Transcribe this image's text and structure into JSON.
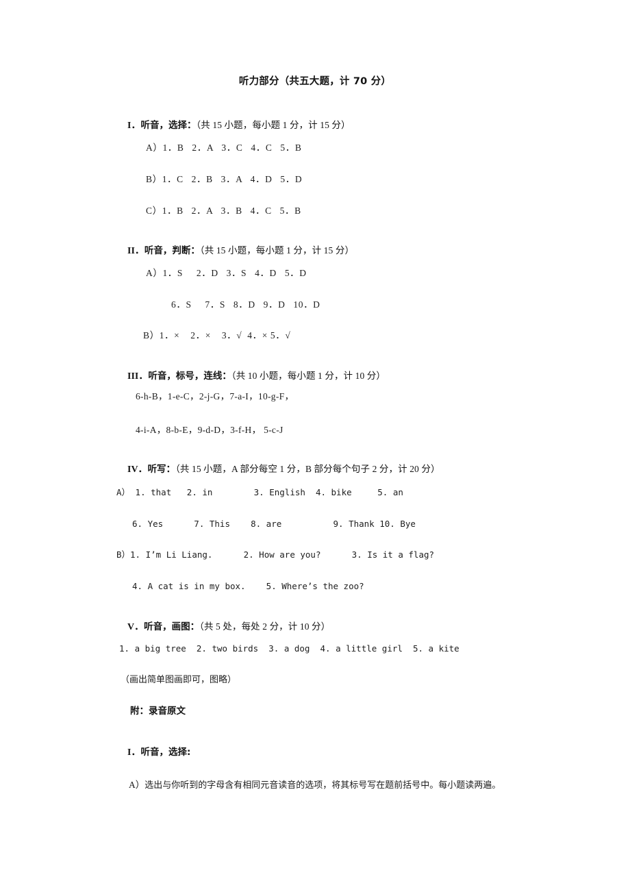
{
  "document": {
    "title": "听力部分（共五大题，计 70 分）"
  },
  "sections": [
    {
      "id": "section-1",
      "number": "I．",
      "name": "听音，选择：",
      "scoring": "（共 15 小题，每小题 1 分，计 15 分）",
      "rows": [
        "A）1．B   2．A   3．C   4．C   5．B",
        "B）1．C   2．B   3．A   4．D   5．D",
        "C）1．B   2．A   3．B   4．C   5．B"
      ]
    },
    {
      "id": "section-2",
      "number": "II．",
      "name": "听音，判断：",
      "scoring": "（共 15 小题，每小题 1 分，计 15 分）",
      "rows": [
        "A）1．S     2．D   3．S   4．D   5．D",
        "6．S     7．S   8．D   9．D   10．D",
        "B）1．×    2．×    3．√  4．× 5．√"
      ]
    },
    {
      "id": "section-3",
      "number": "III．",
      "name": "听音，标号，连线：",
      "scoring": "（共 10 小题，每小题 1 分，计 10 分）",
      "rows": [
        "6-h-B，1-e-C，2-j-G，7-a-I，10-g-F，",
        "4-i-A，8-b-E，9-d-D，3-f-H， 5-c-J"
      ]
    },
    {
      "id": "section-4",
      "number": "IV．",
      "name": "听写：",
      "scoring": "（共 15 小题，A 部分每空 1 分，B 部分每个句子 2 分，计 20 分）",
      "rows": [
        "A） 1. that   2. in        3. English  4. bike     5. an",
        "6. Yes      7. This    8. are          9. Thank 10. Bye",
        "B）1. I’m Li Liang.      2. How are you?      3. Is it a flag?",
        "4. A cat is in my box.    5. Where’s the zoo?"
      ]
    },
    {
      "id": "section-5",
      "number": "V．",
      "name": "听音，画图：",
      "scoring": "（共 5 处，每处 2 分，计 10 分）",
      "rows": [
        "1. a big tree  2. two birds  3. a dog  4. a little girl  5. a kite",
        "（画出简单图画即可，图略）"
      ]
    }
  ],
  "appendix": {
    "heading": "附：录音原文",
    "section_number": "I．",
    "section_name": "听音，选择:",
    "instruction_label": "A）",
    "instruction_text": "选出与你听到的字母含有相同元音读音的选项，将其标号写在题前括号中。每小题读两遍。"
  }
}
